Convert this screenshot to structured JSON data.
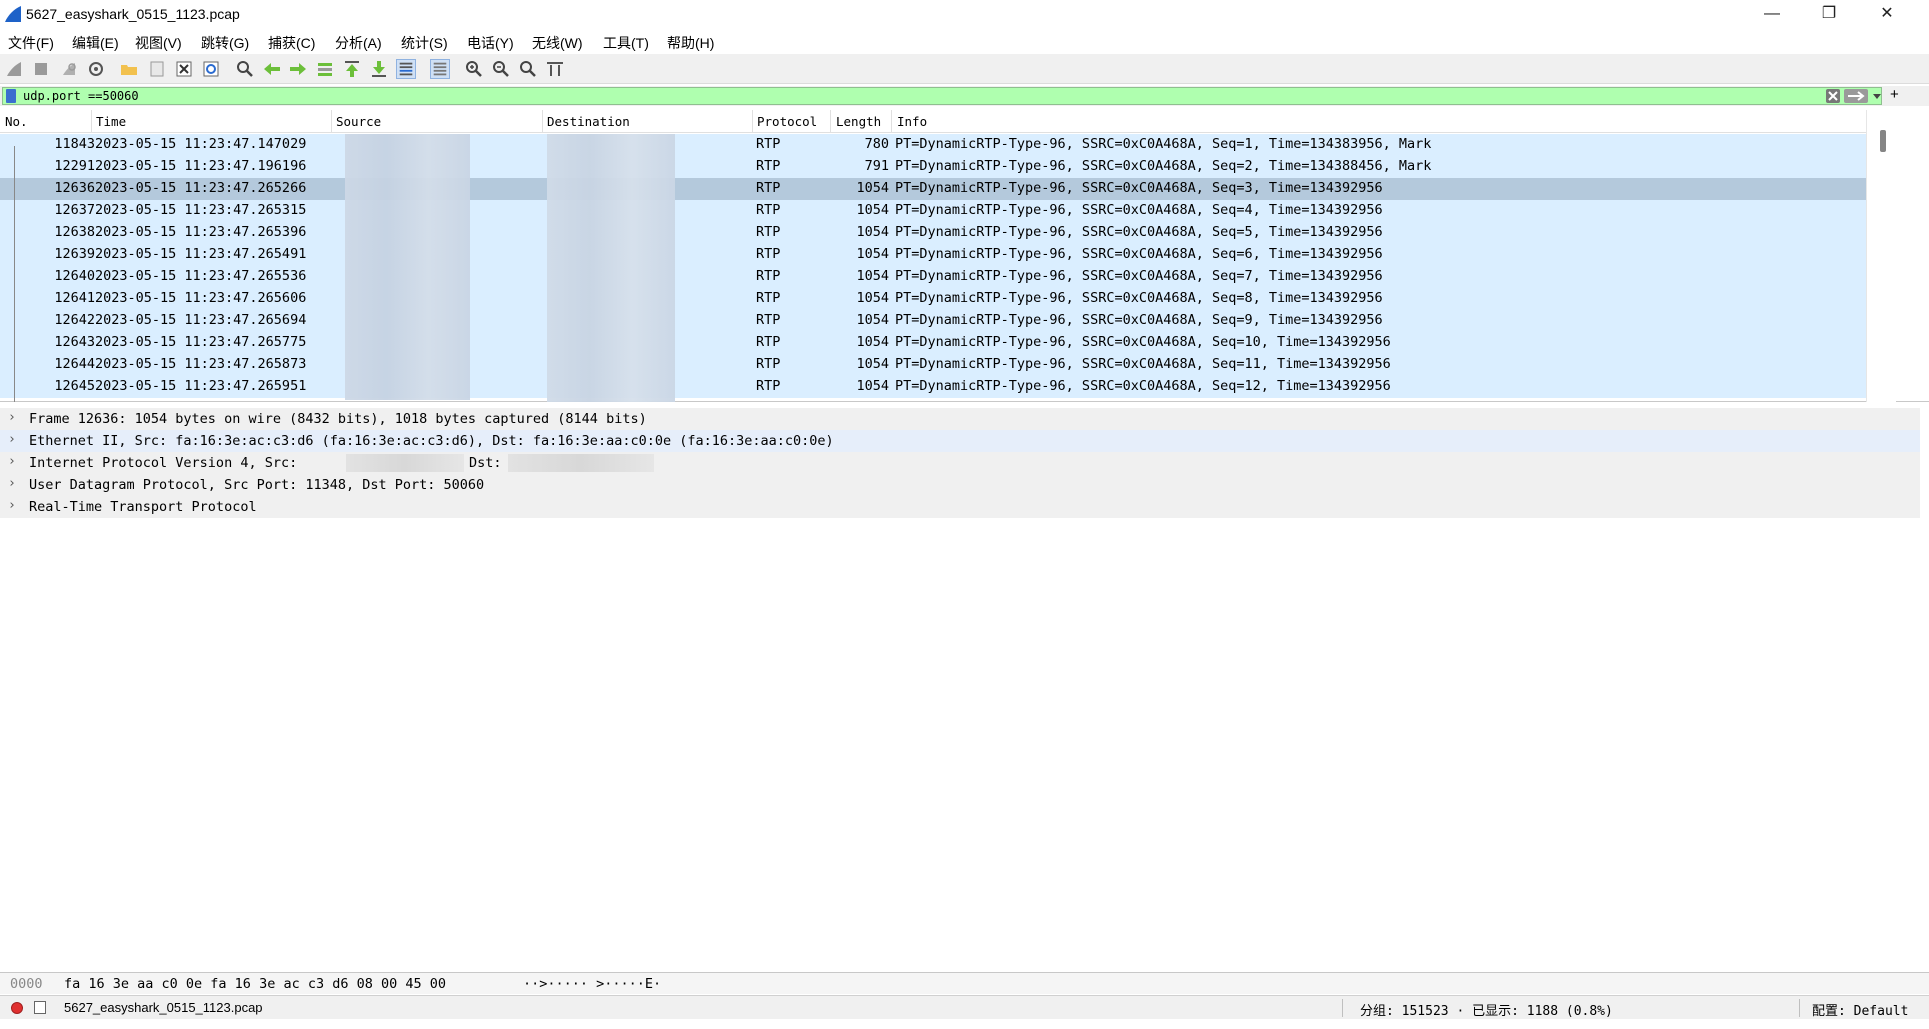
{
  "window": {
    "title": "5627_easyshark_0515_1123.pcap",
    "minimize": "—",
    "maximize": "❐",
    "close": "✕"
  },
  "menu": [
    "文件(F)",
    "编辑(E)",
    "视图(V)",
    "跳转(G)",
    "捕获(C)",
    "分析(A)",
    "统计(S)",
    "电话(Y)",
    "无线(W)",
    "工具(T)",
    "帮助(H)"
  ],
  "toolbar": {
    "icons": [
      "shark-fin-start-icon",
      "stop-icon",
      "restart-icon",
      "capture-options-icon",
      "open-file-icon",
      "save-file-icon",
      "close-file-icon",
      "reload-icon",
      "find-icon",
      "go-back-icon",
      "go-forward-icon",
      "go-to-packet-icon",
      "go-first-icon",
      "go-last-icon",
      "autoscroll-icon",
      "colorize-icon",
      "zoom-in-icon",
      "zoom-out-icon",
      "zoom-normal-icon",
      "resize-columns-icon"
    ]
  },
  "filter": {
    "value": "udp.port ==50060",
    "add_label": "+"
  },
  "packet_list": {
    "columns": {
      "no": "No.",
      "time": "Time",
      "source": "Source",
      "destination": "Destination",
      "protocol": "Protocol",
      "length": "Length",
      "info": "Info"
    },
    "rows": [
      {
        "no": "11843",
        "time": "2023-05-15 11:23:47.147029",
        "protocol": "RTP",
        "length": "780",
        "info": "PT=DynamicRTP-Type-96, SSRC=0xC0A468A, Seq=1, Time=134383956, Mark"
      },
      {
        "no": "12291",
        "time": "2023-05-15 11:23:47.196196",
        "protocol": "RTP",
        "length": "791",
        "info": "PT=DynamicRTP-Type-96, SSRC=0xC0A468A, Seq=2, Time=134388456, Mark"
      },
      {
        "no": "12636",
        "time": "2023-05-15 11:23:47.265266",
        "protocol": "RTP",
        "length": "1054",
        "info": "PT=DynamicRTP-Type-96, SSRC=0xC0A468A, Seq=3, Time=134392956"
      },
      {
        "no": "12637",
        "time": "2023-05-15 11:23:47.265315",
        "protocol": "RTP",
        "length": "1054",
        "info": "PT=DynamicRTP-Type-96, SSRC=0xC0A468A, Seq=4, Time=134392956"
      },
      {
        "no": "12638",
        "time": "2023-05-15 11:23:47.265396",
        "protocol": "RTP",
        "length": "1054",
        "info": "PT=DynamicRTP-Type-96, SSRC=0xC0A468A, Seq=5, Time=134392956"
      },
      {
        "no": "12639",
        "time": "2023-05-15 11:23:47.265491",
        "protocol": "RTP",
        "length": "1054",
        "info": "PT=DynamicRTP-Type-96, SSRC=0xC0A468A, Seq=6, Time=134392956"
      },
      {
        "no": "12640",
        "time": "2023-05-15 11:23:47.265536",
        "protocol": "RTP",
        "length": "1054",
        "info": "PT=DynamicRTP-Type-96, SSRC=0xC0A468A, Seq=7, Time=134392956"
      },
      {
        "no": "12641",
        "time": "2023-05-15 11:23:47.265606",
        "protocol": "RTP",
        "length": "1054",
        "info": "PT=DynamicRTP-Type-96, SSRC=0xC0A468A, Seq=8, Time=134392956"
      },
      {
        "no": "12642",
        "time": "2023-05-15 11:23:47.265694",
        "protocol": "RTP",
        "length": "1054",
        "info": "PT=DynamicRTP-Type-96, SSRC=0xC0A468A, Seq=9, Time=134392956"
      },
      {
        "no": "12643",
        "time": "2023-05-15 11:23:47.265775",
        "protocol": "RTP",
        "length": "1054",
        "info": "PT=DynamicRTP-Type-96, SSRC=0xC0A468A, Seq=10, Time=134392956"
      },
      {
        "no": "12644",
        "time": "2023-05-15 11:23:47.265873",
        "protocol": "RTP",
        "length": "1054",
        "info": "PT=DynamicRTP-Type-96, SSRC=0xC0A468A, Seq=11, Time=134392956"
      },
      {
        "no": "12645",
        "time": "2023-05-15 11:23:47.265951",
        "protocol": "RTP",
        "length": "1054",
        "info": "PT=DynamicRTP-Type-96, SSRC=0xC0A468A, Seq=12, Time=134392956"
      }
    ]
  },
  "details": {
    "lines": [
      "Frame 12636: 1054 bytes on wire (8432 bits), 1018 bytes captured (8144 bits)",
      "Ethernet II, Src: fa:16:3e:ac:c3:d6 (fa:16:3e:ac:c3:d6), Dst: fa:16:3e:aa:c0:0e (fa:16:3e:aa:c0:0e)",
      "Internet Protocol Version 4, Src:",
      "User Datagram Protocol, Src Port: 11348, Dst Port: 50060",
      "Real-Time Transport Protocol"
    ],
    "ip_dst_label": "Dst:"
  },
  "hex": {
    "offset": "0000",
    "bytes": "fa 16 3e aa c0 0e fa 16  3e ac c3 d6 08 00 45 00",
    "ascii": "··>·····  >·····E·"
  },
  "status": {
    "file": "5627_easyshark_0515_1123.pcap",
    "packets": "分组: 151523 · 已显示: 1188 (0.8%)",
    "profile": "配置: Default"
  },
  "colors": {
    "filter_bg": "#afffaf",
    "row_bg": "#daeeff",
    "row_selected": "#b4c9dc"
  }
}
